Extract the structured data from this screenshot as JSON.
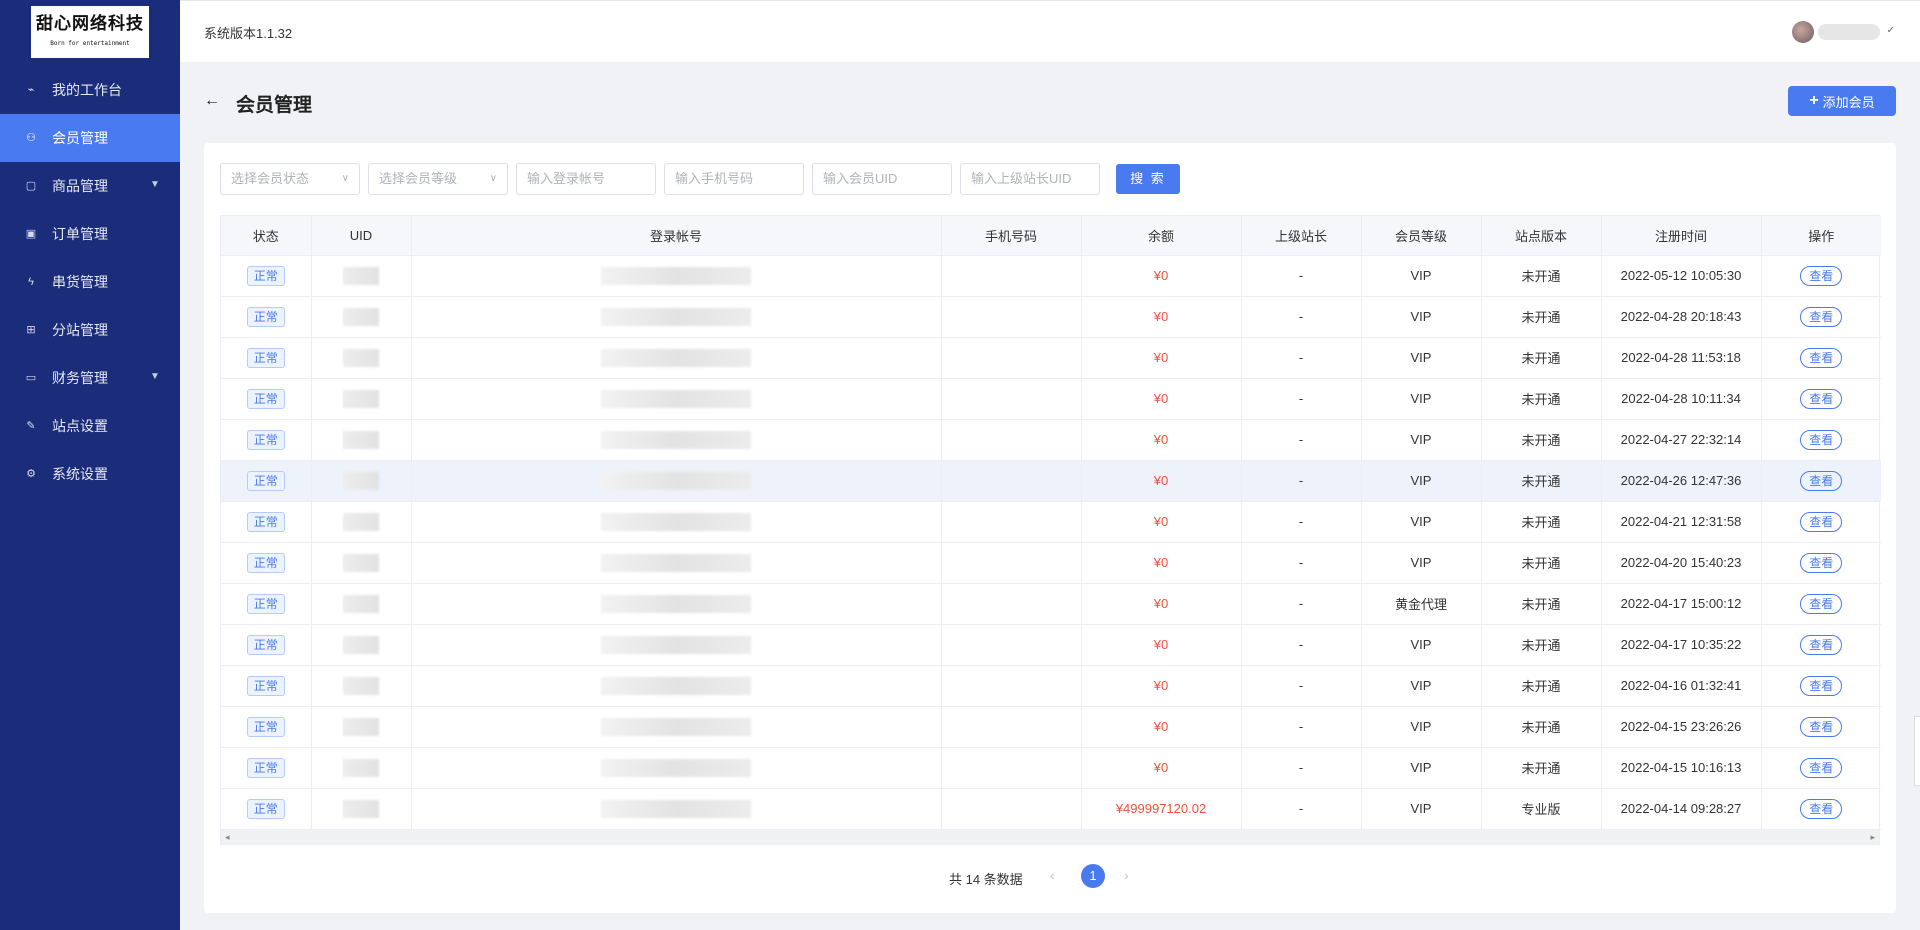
{
  "logo": {
    "title": "甜心网络科技",
    "subtitle": "Born for entertainment"
  },
  "sidebar": {
    "items": [
      {
        "label": "我的工作台",
        "icon": "chart-line-icon",
        "glyph": "⌁"
      },
      {
        "label": "会员管理",
        "icon": "users-icon",
        "glyph": "⚇"
      },
      {
        "label": "商品管理",
        "icon": "bag-icon",
        "glyph": "▢"
      },
      {
        "label": "订单管理",
        "icon": "order-icon",
        "glyph": "▣"
      },
      {
        "label": "串货管理",
        "icon": "lightning-icon",
        "glyph": "ϟ"
      },
      {
        "label": "分站管理",
        "icon": "sitemap-icon",
        "glyph": "⊞"
      },
      {
        "label": "财务管理",
        "icon": "card-icon",
        "glyph": "▭"
      },
      {
        "label": "站点设置",
        "icon": "wrench-icon",
        "glyph": "✎"
      },
      {
        "label": "系统设置",
        "icon": "gear-icon",
        "glyph": "⚙"
      }
    ]
  },
  "header": {
    "version": "系统版本1.1.32",
    "caret": "✓"
  },
  "page": {
    "title": "会员管理",
    "add_button": "添加会员"
  },
  "filters": {
    "status_placeholder": "选择会员状态",
    "level_placeholder": "选择会员等级",
    "account_placeholder": "输入登录帐号",
    "phone_placeholder": "输入手机号码",
    "uid_placeholder": "输入会员UID",
    "parent_uid_placeholder": "输入上级站长UID",
    "search_label": "搜 索"
  },
  "table": {
    "columns": [
      "状态",
      "UID",
      "登录帐号",
      "手机号码",
      "余额",
      "上级站长",
      "会员等级",
      "站点版本",
      "注册时间",
      "操作"
    ],
    "rows": [
      {
        "status": "正常",
        "balance": "¥0",
        "parent": "-",
        "level": "VIP",
        "version": "未开通",
        "time": "2022-05-12 10:05:30",
        "action": "查看"
      },
      {
        "status": "正常",
        "balance": "¥0",
        "parent": "-",
        "level": "VIP",
        "version": "未开通",
        "time": "2022-04-28 20:18:43",
        "action": "查看"
      },
      {
        "status": "正常",
        "balance": "¥0",
        "parent": "-",
        "level": "VIP",
        "version": "未开通",
        "time": "2022-04-28 11:53:18",
        "action": "查看"
      },
      {
        "status": "正常",
        "balance": "¥0",
        "parent": "-",
        "level": "VIP",
        "version": "未开通",
        "time": "2022-04-28 10:11:34",
        "action": "查看"
      },
      {
        "status": "正常",
        "balance": "¥0",
        "parent": "-",
        "level": "VIP",
        "version": "未开通",
        "time": "2022-04-27 22:32:14",
        "action": "查看"
      },
      {
        "status": "正常",
        "balance": "¥0",
        "parent": "-",
        "level": "VIP",
        "version": "未开通",
        "time": "2022-04-26 12:47:36",
        "action": "查看"
      },
      {
        "status": "正常",
        "balance": "¥0",
        "parent": "-",
        "level": "VIP",
        "version": "未开通",
        "time": "2022-04-21 12:31:58",
        "action": "查看"
      },
      {
        "status": "正常",
        "balance": "¥0",
        "parent": "-",
        "level": "VIP",
        "version": "未开通",
        "time": "2022-04-20 15:40:23",
        "action": "查看"
      },
      {
        "status": "正常",
        "balance": "¥0",
        "parent": "-",
        "level": "黄金代理",
        "version": "未开通",
        "time": "2022-04-17 15:00:12",
        "action": "查看"
      },
      {
        "status": "正常",
        "balance": "¥0",
        "parent": "-",
        "level": "VIP",
        "version": "未开通",
        "time": "2022-04-17 10:35:22",
        "action": "查看"
      },
      {
        "status": "正常",
        "balance": "¥0",
        "parent": "-",
        "level": "VIP",
        "version": "未开通",
        "time": "2022-04-16 01:32:41",
        "action": "查看"
      },
      {
        "status": "正常",
        "balance": "¥0",
        "parent": "-",
        "level": "VIP",
        "version": "未开通",
        "time": "2022-04-15 23:26:26",
        "action": "查看"
      },
      {
        "status": "正常",
        "balance": "¥0",
        "parent": "-",
        "level": "VIP",
        "version": "未开通",
        "time": "2022-04-15 10:16:13",
        "action": "查看"
      },
      {
        "status": "正常",
        "balance": "¥499997120.02",
        "parent": "-",
        "level": "VIP",
        "version": "专业版",
        "time": "2022-04-14 09:28:27",
        "action": "查看"
      }
    ]
  },
  "pagination": {
    "total": "共 14 条数据",
    "current": "1"
  },
  "colors": {
    "sidebar": "#1a2c7a",
    "accent": "#4a7af0",
    "money": "#f0503c"
  }
}
